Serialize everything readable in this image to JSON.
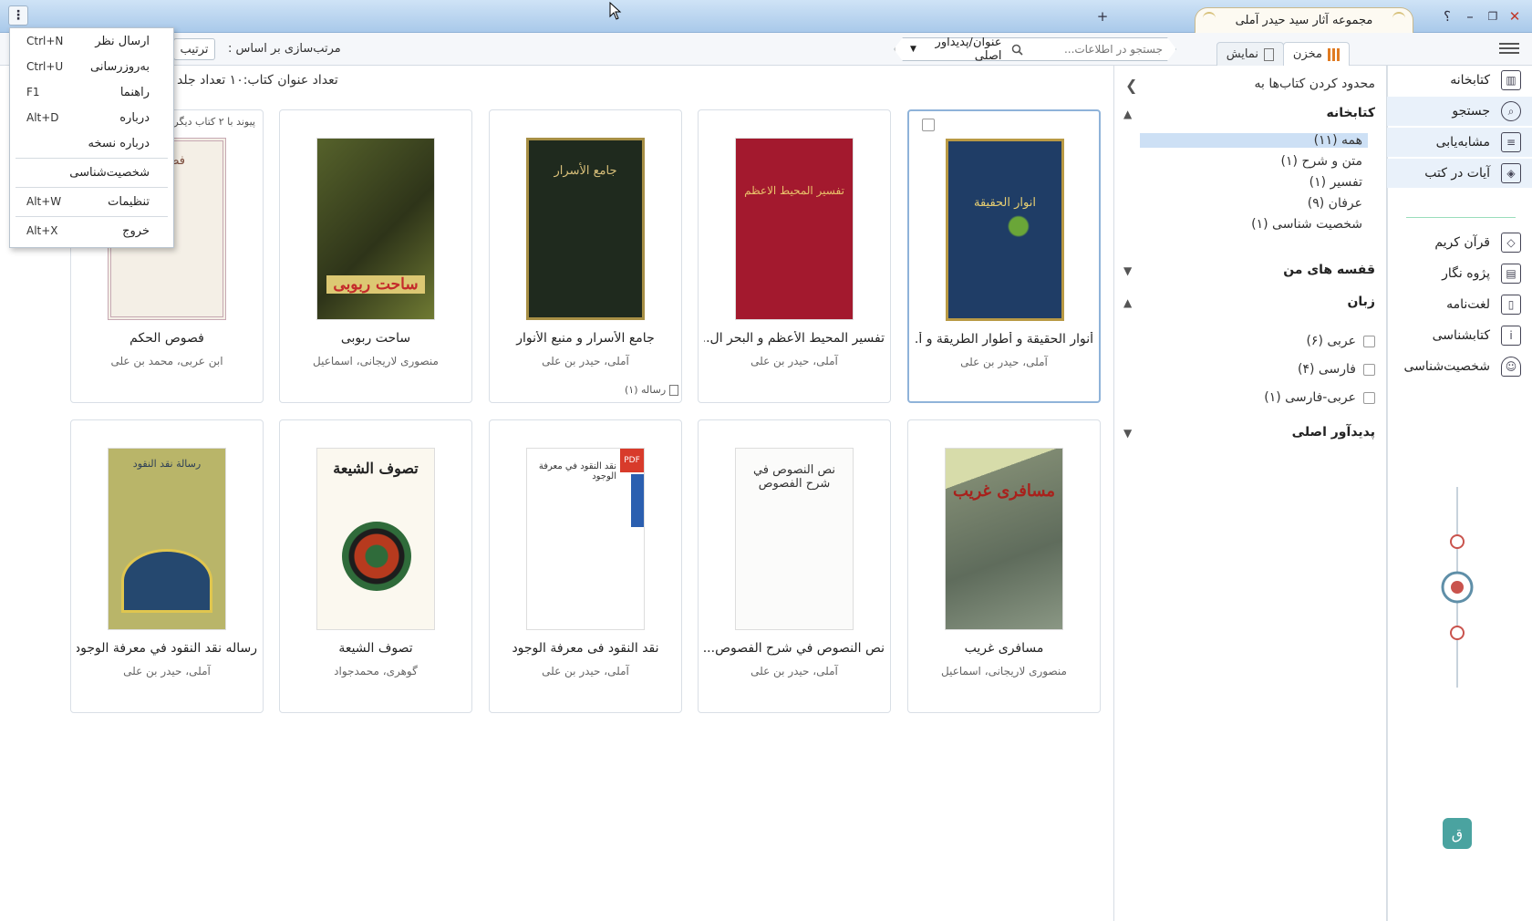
{
  "window": {
    "title": "مجموعه آثار سید حیدر آملی",
    "new_tab": "+",
    "help": "؟",
    "minimize": "–",
    "restore": "❐",
    "close": "✕"
  },
  "toolbar": {
    "makhzan": "مخزن",
    "namayesh": "نمایش",
    "search_placeholder": "جستجو در اطلاعات...",
    "search_field": "عنوان/پدیدآور اصلی",
    "sort_label": "مرتب‌سازی بر اساس :",
    "sort_value": "ترتیب"
  },
  "content": {
    "count_text": "تعداد عنوان کتاب:۱۰   تعداد جلد",
    "link_note": "پیوند با ۲ کتاب دیگر"
  },
  "books": [
    {
      "title": "أنوار الحقيقة و أطوار الطريقة و أ...",
      "author": "آملی، حیدر بن علی",
      "cover_text": "انوار الحقیقة"
    },
    {
      "title": "تفسير المحيط الأعظم و البحر ال...",
      "author": "آملی، حیدر بن علی",
      "cover_text": "تفسیر المحیط الاعظم"
    },
    {
      "title": "جامع الأسرار و منبع الأنوار",
      "author": "آملی، حیدر بن علی",
      "cover_text": "جامع الأسرار",
      "badge": "رساله (۱)"
    },
    {
      "title": "ساحت ربوبی",
      "author": "منصوری لاریجانی، اسماعیل",
      "cover_text": "ساحت ربوبی"
    },
    {
      "title": "فصوص الحکم",
      "author": "ابن عربی، محمد بن علی",
      "cover_text": "فصوص"
    },
    {
      "title": "مسافری غریب",
      "author": "منصوری لاریجانی، اسماعیل",
      "cover_text": "مسافری غریب"
    },
    {
      "title": "نص النصوص في شرح الفصوص...",
      "author": "آملی، حیدر بن علی",
      "cover_text": "نص النصوص في شرح الفصوص"
    },
    {
      "title": "نقد النقود فی معرفة الوجود",
      "author": "آملی، حیدر بن علی",
      "cover_text": "نقد النقود في معرفة الوجود"
    },
    {
      "title": "تصوف الشيعة",
      "author": "گوهری، محمدجواد",
      "cover_text": "تصوف الشيعة"
    },
    {
      "title": "رساله نقد النقود في معرفة الوجود",
      "author": "آملی، حیدر بن علی",
      "cover_text": "رسالة نقد النقود"
    }
  ],
  "filters": {
    "limit_title": "محدود کردن کتاب‌ها به",
    "library_header": "کتابخانه",
    "library_items": [
      "همه (۱۱)",
      "متن و شرح (۱)",
      "تفسیر (۱)",
      "عرفان (۹)",
      "شخصیت شناسی (۱)"
    ],
    "shelves_header": "قفسه های من",
    "language_header": "زبان",
    "languages": [
      "عربی (۶)",
      "فارسی (۴)",
      "عربی-فارسی (۱)"
    ],
    "author_header": "پدیدآور اصلی"
  },
  "sidebar": {
    "items": [
      {
        "label": "کتابخانه",
        "icon": "library-icon"
      },
      {
        "label": "جستجو",
        "icon": "search-icon"
      },
      {
        "label": "مشابه‌یابی",
        "icon": "similar-icon"
      },
      {
        "label": "آیات در کتب",
        "icon": "verses-icon"
      },
      {
        "label": "قرآن کریم",
        "icon": "quran-icon"
      },
      {
        "label": "پژوه نگار",
        "icon": "notebook-icon"
      },
      {
        "label": "لغت‌نامه",
        "icon": "dictionary-icon"
      },
      {
        "label": "کتابشناسی",
        "icon": "bibliography-icon"
      },
      {
        "label": "شخصیت‌شناسی",
        "icon": "person-icon"
      }
    ]
  },
  "popup_menu": [
    {
      "label": "ارسال نظر",
      "shortcut": "Ctrl+N"
    },
    {
      "label": "به‌روزرسانی",
      "shortcut": "Ctrl+U"
    },
    {
      "label": "راهنما",
      "shortcut": "F1"
    },
    {
      "label": "درباره",
      "shortcut": "Alt+D"
    },
    {
      "label": "درباره نسخه",
      "shortcut": ""
    },
    {
      "label": "شخصیت‌شناسی",
      "shortcut": ""
    },
    {
      "label": "تنظیمات",
      "shortcut": "Alt+W"
    },
    {
      "label": "خروج",
      "shortcut": "Alt+X"
    }
  ]
}
